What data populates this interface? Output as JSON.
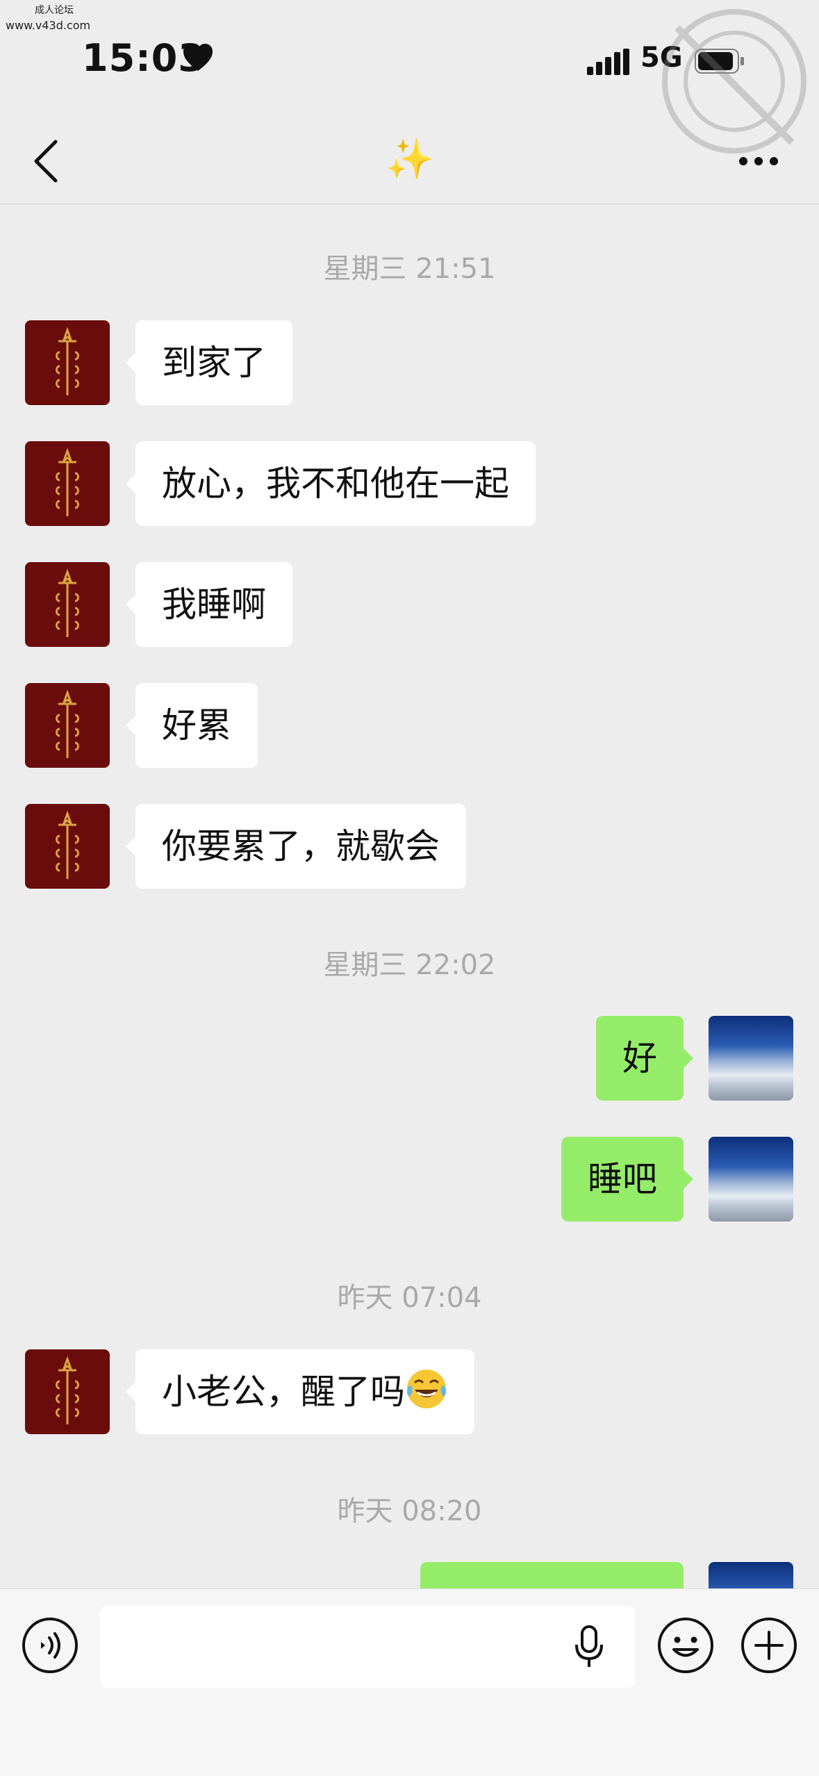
{
  "watermark": {
    "line1": "成人论坛",
    "line2": "www.v43d.com"
  },
  "status_bar": {
    "time": "15:03",
    "network": "5G",
    "heart_icon": "heart-icon",
    "signal_icon": "signal-icon",
    "battery_icon": "battery-icon"
  },
  "nav": {
    "title": "✨",
    "back_icon": "chevron-left-icon",
    "more_icon": "more-dots-icon"
  },
  "messages": [
    {
      "type": "timestamp",
      "text": "星期三 21:51"
    },
    {
      "type": "message",
      "side": "left",
      "text": "到家了"
    },
    {
      "type": "message",
      "side": "left",
      "text": "放心，我不和他在一起"
    },
    {
      "type": "message",
      "side": "left",
      "text": "我睡啊"
    },
    {
      "type": "message",
      "side": "left",
      "text": "好累"
    },
    {
      "type": "message",
      "side": "left",
      "text": "你要累了，就歇会"
    },
    {
      "type": "timestamp",
      "text": "星期三 22:02"
    },
    {
      "type": "message",
      "side": "right",
      "text": "好"
    },
    {
      "type": "message",
      "side": "right",
      "text": "睡吧"
    },
    {
      "type": "timestamp",
      "text": "昨天 07:04"
    },
    {
      "type": "message",
      "side": "left",
      "text": "小老公，醒了吗",
      "emoji": "tears-of-joy-emoji"
    },
    {
      "type": "timestamp",
      "text": "昨天 08:20"
    },
    {
      "type": "message",
      "side": "right",
      "text": ""
    }
  ],
  "input_bar": {
    "voice_icon": "voice-toggle-icon",
    "input_value": "",
    "mic_icon": "microphone-icon",
    "emoji_icon": "smiley-icon",
    "plus_icon": "plus-icon"
  },
  "colors": {
    "background": "#ededed",
    "bubble_self": "#95ec69",
    "bubble_other": "#ffffff",
    "timestamp": "#a9a9a9"
  }
}
